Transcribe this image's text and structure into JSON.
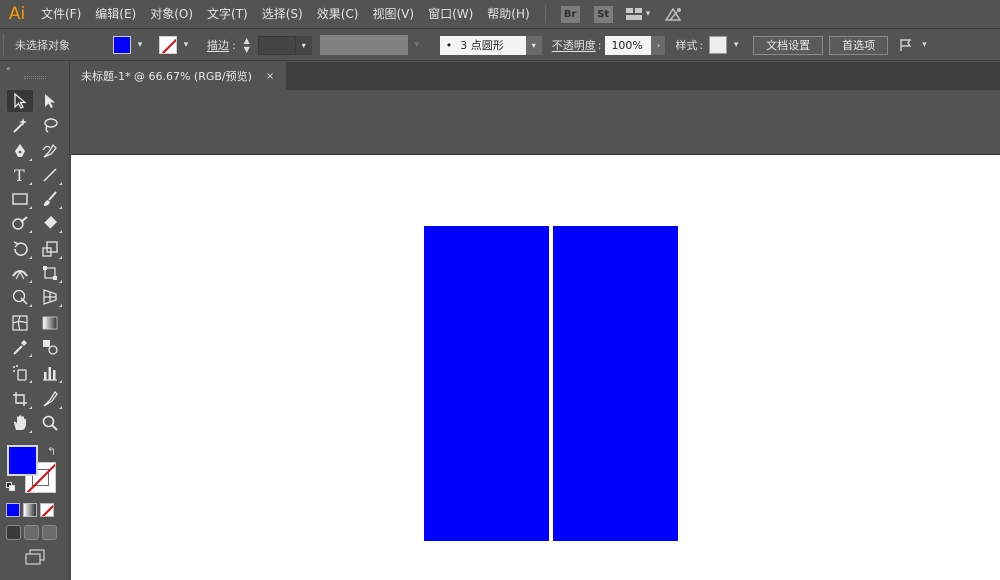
{
  "app": {
    "logo": "Ai"
  },
  "menu": {
    "items": [
      "文件(F)",
      "编辑(E)",
      "对象(O)",
      "文字(T)",
      "选择(S)",
      "效果(C)",
      "视图(V)",
      "窗口(W)",
      "帮助(H)"
    ],
    "bridge_badge": "Br",
    "stock_badge": "St",
    "chevron": "⌄"
  },
  "control": {
    "selection_status": "未选择对象",
    "fill_color": "#0000ff",
    "stroke_label": "描边",
    "stroke_colon": ":",
    "brush_value": "3 点圆形",
    "brush_dot": "•",
    "opacity_label": "不透明度",
    "opacity_colon": ":",
    "opacity_value": "100%",
    "style_label": "样式",
    "style_colon": ":",
    "doc_setup_button": "文档设置",
    "prefs_button": "首选项"
  },
  "toolbar": {
    "collapse_arrows": "«",
    "fill_color": "#0000ff",
    "swap_glyph": "↰"
  },
  "document": {
    "tab_title": "未标题-1* @ 66.67% (RGB/预览)",
    "tab_close": "×"
  },
  "artwork": {
    "shapes": [
      {
        "name": "blue-rectangle-left",
        "fill": "#0000ff"
      },
      {
        "name": "blue-rectangle-right",
        "fill": "#0000ff"
      }
    ]
  }
}
